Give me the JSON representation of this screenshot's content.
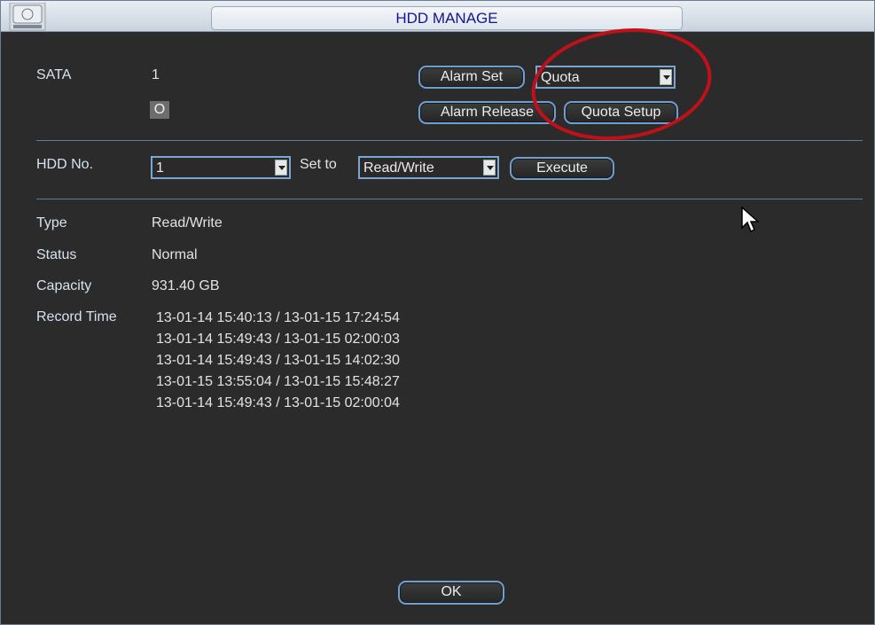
{
  "window": {
    "title": "HDD MANAGE"
  },
  "disk": {
    "sata_label": "SATA",
    "sata_number": "1",
    "sata_status_box": "O"
  },
  "buttons": {
    "alarm_set": "Alarm Set",
    "alarm_release": "Alarm Release",
    "quota_setup": "Quota Setup",
    "execute": "Execute",
    "ok": "OK"
  },
  "selects": {
    "mode": "Quota",
    "hdd_no": "1",
    "set_to": "Read/Write"
  },
  "labels": {
    "hdd_no": "HDD No.",
    "set_to": "Set to",
    "type": "Type",
    "status": "Status",
    "capacity": "Capacity",
    "record_time": "Record Time"
  },
  "info": {
    "type": "Read/Write",
    "status": "Normal",
    "capacity": "931.40 GB"
  },
  "record_times": [
    "13-01-14 15:40:13 / 13-01-15 17:24:54",
    "13-01-14 15:49:43 / 13-01-15 02:00:03",
    "13-01-14 15:49:43 / 13-01-15 14:02:30",
    "13-01-15 13:55:04 / 13-01-15 15:48:27",
    "13-01-14 15:49:43 / 13-01-15 02:00:04"
  ],
  "colors": {
    "title_text": "#14148f",
    "label_text": "#d6e2f0",
    "button_border": "#6f9fd0",
    "annotation_circle": "#c0101a"
  }
}
